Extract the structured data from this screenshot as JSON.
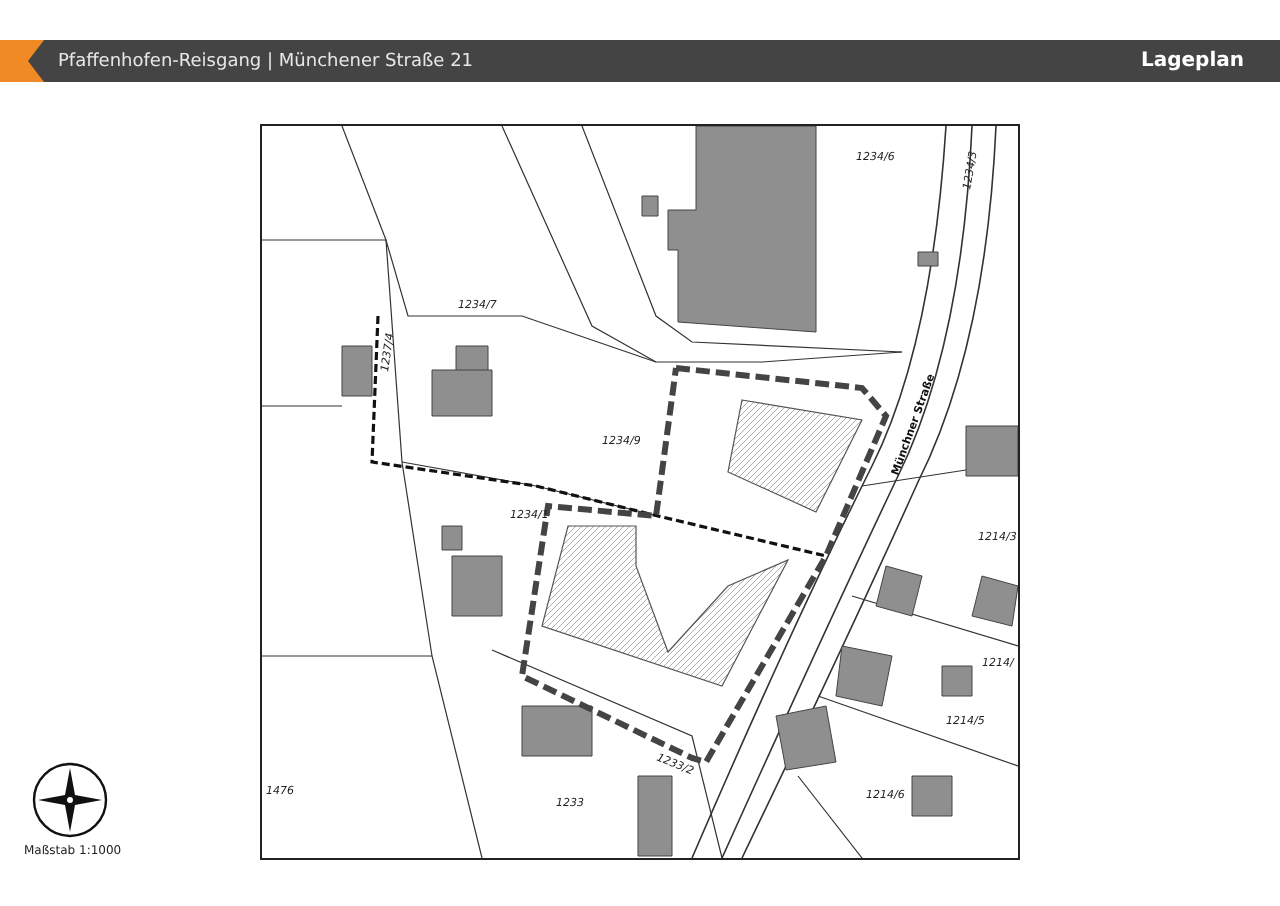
{
  "header": {
    "project": "Pfaffenhofen-Reisgang | Münchener Straße 21",
    "title": "Lageplan"
  },
  "legend": {
    "scale": "Maßstab 1:1000"
  },
  "plan": {
    "street_name": "Münchner Straße",
    "parcels": [
      "1234/6",
      "1234/3",
      "1234/7",
      "1237/4",
      "1234/9",
      "1234/1",
      "1214/3",
      "1214/",
      "1214/5",
      "1214/6",
      "1476",
      "1233",
      "1233/2"
    ]
  }
}
